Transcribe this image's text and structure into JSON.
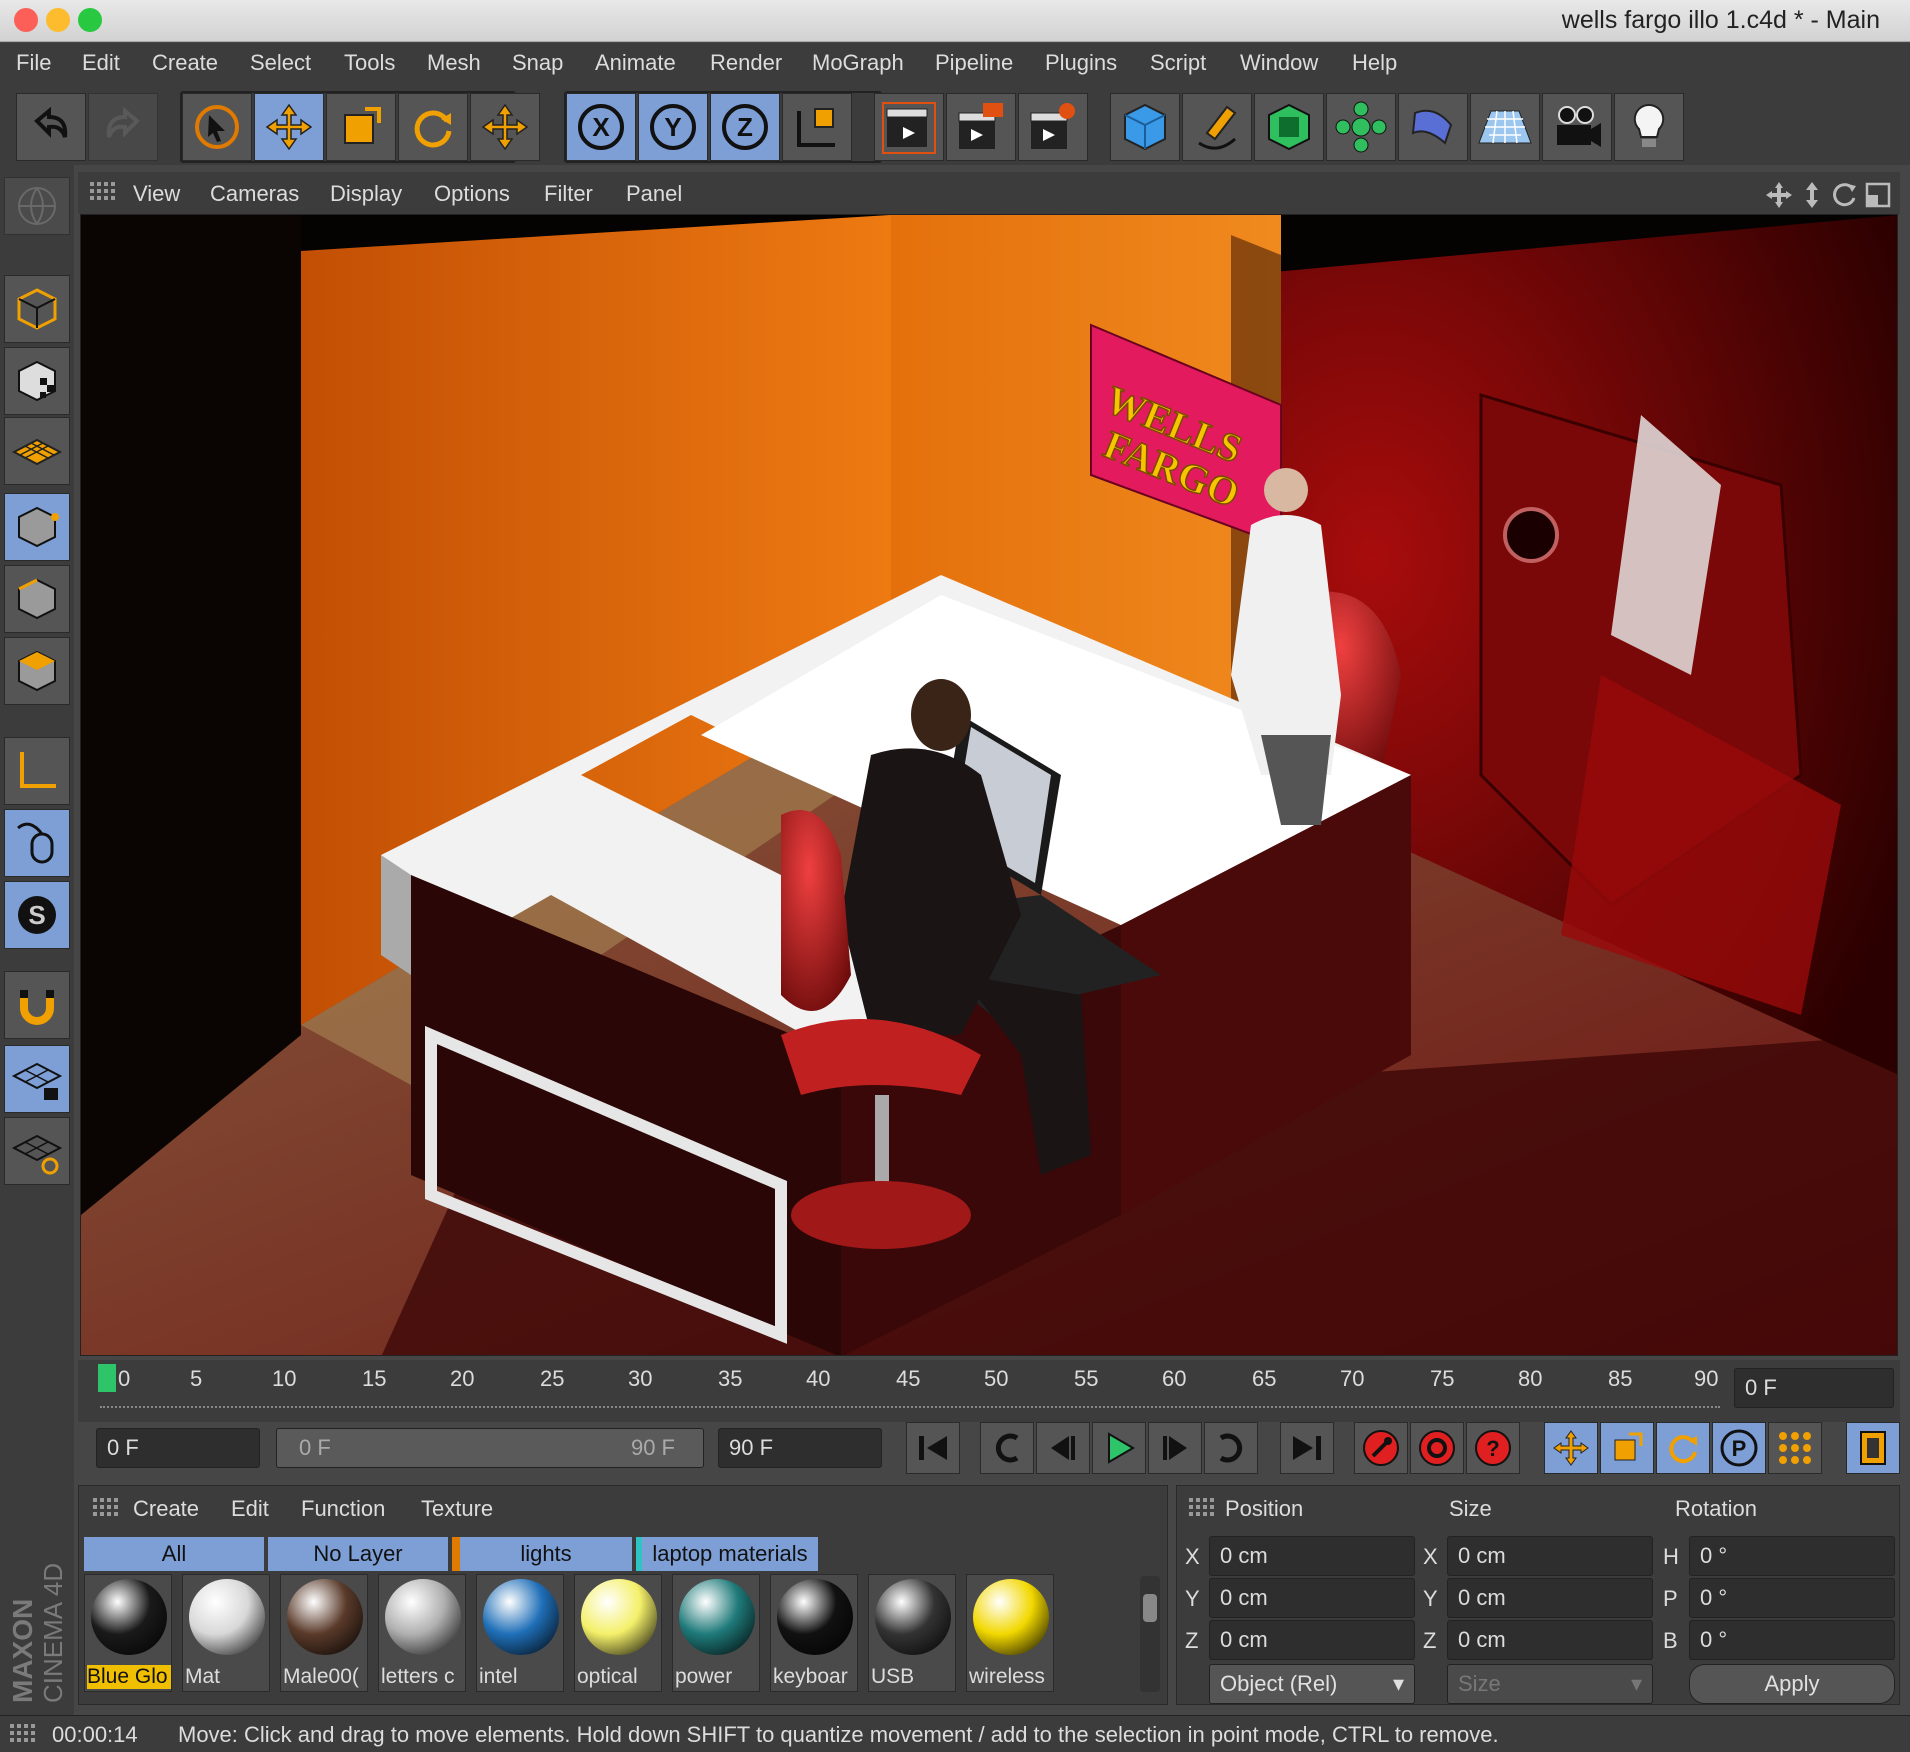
{
  "window": {
    "title": "wells fargo illo 1.c4d * - Main"
  },
  "menu": [
    "File",
    "Edit",
    "Create",
    "Select",
    "Tools",
    "Mesh",
    "Snap",
    "Animate",
    "Render",
    "MoGraph",
    "Pipeline",
    "Plugins",
    "Script",
    "Window",
    "Help"
  ],
  "toolbar_axes": {
    "x": "X",
    "y": "Y",
    "z": "Z"
  },
  "viewport_menu": [
    "View",
    "Cameras",
    "Display",
    "Options",
    "Filter",
    "Panel"
  ],
  "scene": {
    "sign_line1": "WELLS",
    "sign_line2": "FARGO"
  },
  "timeline": {
    "ticks": [
      "0",
      "5",
      "10",
      "15",
      "20",
      "25",
      "30",
      "35",
      "40",
      "45",
      "50",
      "55",
      "60",
      "65",
      "70",
      "75",
      "80",
      "85",
      "90"
    ],
    "current_frame": "0 F"
  },
  "playback": {
    "start": "0 F",
    "range_start": "0 F",
    "range_end": "90 F",
    "end": "90 F"
  },
  "material_menu": [
    "Create",
    "Edit",
    "Function",
    "Texture"
  ],
  "material_tabs": [
    "All",
    "No Layer",
    "lights",
    "laptop materials"
  ],
  "materials": [
    {
      "label": "Blue Glo",
      "color": "#1a1a1a"
    },
    {
      "label": "Mat",
      "color": "#d8d8d8"
    },
    {
      "label": "Male00(",
      "color": "#5a3a2a"
    },
    {
      "label": "letters c",
      "color": "#b0b0b0"
    },
    {
      "label": "intel",
      "color": "#1f6fb8"
    },
    {
      "label": "optical",
      "color": "#f4f06a"
    },
    {
      "label": "power",
      "color": "#1f7a7a"
    },
    {
      "label": "keyboar",
      "color": "#111111"
    },
    {
      "label": "USB",
      "color": "#333333"
    },
    {
      "label": "wireless",
      "color": "#f2d800"
    }
  ],
  "attributes": {
    "headers": [
      "Position",
      "Size",
      "Rotation"
    ],
    "position": [
      {
        "axis": "X",
        "value": "0 cm"
      },
      {
        "axis": "Y",
        "value": "0 cm"
      },
      {
        "axis": "Z",
        "value": "0 cm"
      }
    ],
    "size": [
      {
        "axis": "X",
        "value": "0 cm"
      },
      {
        "axis": "Y",
        "value": "0 cm"
      },
      {
        "axis": "Z",
        "value": "0 cm"
      }
    ],
    "rotation": [
      {
        "axis": "H",
        "value": "0 °"
      },
      {
        "axis": "P",
        "value": "0 °"
      },
      {
        "axis": "B",
        "value": "0 °"
      }
    ],
    "mode": "Object (Rel)",
    "size_mode": "Size",
    "apply": "Apply"
  },
  "branding": {
    "maxon": "MAXON",
    "product": "CINEMA 4D"
  },
  "status": {
    "time": "00:00:14",
    "message": "Move: Click and drag to move elements. Hold down SHIFT to quantize movement / add to the selection in point mode, CTRL to remove."
  },
  "colors": {
    "accent": "#7d9fd6",
    "wall": "#e06a10",
    "panel": "#3c3c3c"
  }
}
